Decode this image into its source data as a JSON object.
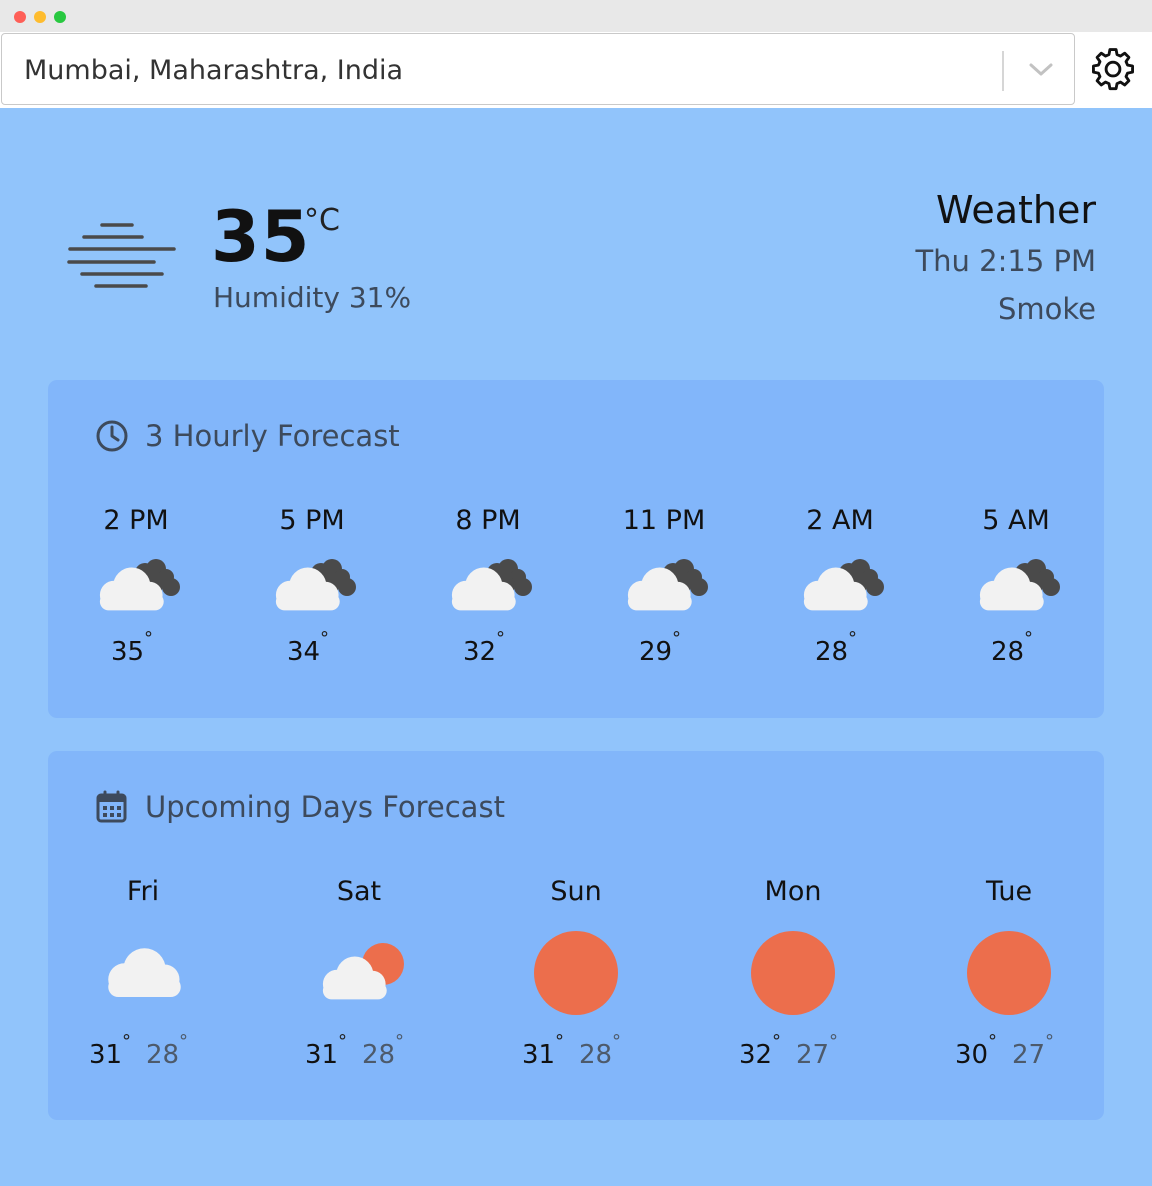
{
  "location": {
    "value": "Mumbai, Maharashtra, India"
  },
  "current": {
    "temperature": "35",
    "unit": "°C",
    "humidity": "Humidity 31%",
    "icon": "smoke-haze-icon"
  },
  "summary": {
    "title": "Weather",
    "time": "Thu 2:15 PM",
    "condition": "Smoke"
  },
  "hourly": {
    "title": "3 Hourly Forecast",
    "icon": "clock-icon",
    "items": [
      {
        "time": "2 PM",
        "temp": "35",
        "icon": "cloudy-icon"
      },
      {
        "time": "5 PM",
        "temp": "34",
        "icon": "cloudy-icon"
      },
      {
        "time": "8 PM",
        "temp": "32",
        "icon": "cloudy-icon"
      },
      {
        "time": "11 PM",
        "temp": "29",
        "icon": "cloudy-icon"
      },
      {
        "time": "2 AM",
        "temp": "28",
        "icon": "cloudy-icon"
      },
      {
        "time": "5 AM",
        "temp": "28",
        "icon": "cloudy-icon"
      }
    ]
  },
  "daily": {
    "title": "Upcoming Days Forecast",
    "icon": "calendar-icon",
    "items": [
      {
        "day": "Fri",
        "high": "31",
        "low": "28",
        "icon": "cloud-icon"
      },
      {
        "day": "Sat",
        "high": "31",
        "low": "28",
        "icon": "partly-sunny-icon"
      },
      {
        "day": "Sun",
        "high": "31",
        "low": "28",
        "icon": "sun-icon"
      },
      {
        "day": "Mon",
        "high": "32",
        "low": "27",
        "icon": "sun-icon"
      },
      {
        "day": "Tue",
        "high": "30",
        "low": "27",
        "icon": "sun-icon"
      }
    ]
  },
  "degree_symbol": "°",
  "colors": {
    "background": "#91c4fb",
    "card": "#82b6fa",
    "sun": "#ec6e4c",
    "cloud_light": "#f2f2f2",
    "cloud_dark": "#4a4a4a"
  }
}
